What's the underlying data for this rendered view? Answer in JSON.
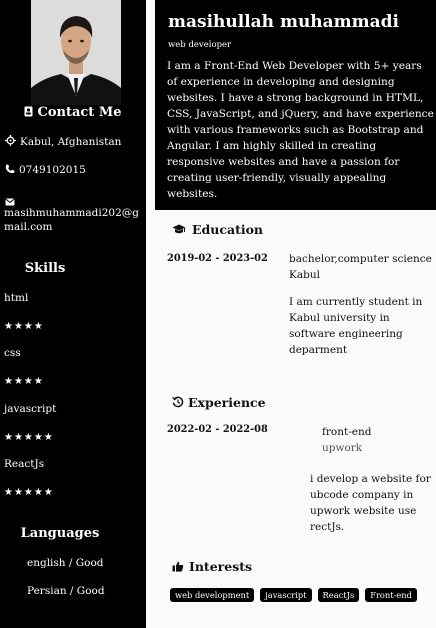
{
  "profile": {
    "name": "masihullah muhammadi",
    "role": "web developer",
    "summary": "I am a Front-End Web Developer with 5+ years of experience in developing and designing websites. I have a strong background in HTML, CSS, JavaScript, and jQuery, and have experience with various frameworks such as Bootstrap and Angular. I am highly skilled in creating responsive websites and have a passion for creating user-friendly, visually appealing websites."
  },
  "contact": {
    "title": "Contact Me",
    "location": "Kabul, Afghanistan",
    "phone": "0749102015",
    "email": "masihmuhammadi202@gmail.com"
  },
  "skills": {
    "title": "Skills",
    "items": [
      {
        "name": "html",
        "stars": "★★★★",
        "rating": 4
      },
      {
        "name": "css",
        "stars": "★★★★",
        "rating": 4
      },
      {
        "name": "javascript",
        "stars": "★★★★★",
        "rating": 5
      },
      {
        "name": "ReactJs",
        "stars": "★★★★★",
        "rating": 5
      }
    ]
  },
  "languages": {
    "title": "Languages",
    "items": [
      "english / Good",
      "Persian / Good"
    ]
  },
  "education": {
    "title": "Education",
    "dates": "2019-02 - 2023-02",
    "degree": "bachelor,computer science",
    "place": "Kabul",
    "description": "I am currently student in Kabul university in software engineering deparment"
  },
  "experience": {
    "title": "Experience",
    "dates": "2022-02 - 2022-08",
    "position": "front-end",
    "company": "upwork",
    "description": "i develop a website for ubcode company in upwork website use rectJs."
  },
  "interests": {
    "title": "Interests",
    "tags": [
      "web development",
      "javascript",
      "ReactJs",
      "Front-end"
    ]
  },
  "colors": {
    "sidebar_bg": "#000000",
    "header_bg": "#000000",
    "page_bg": "#fafafa",
    "tag_bg": "#000000"
  }
}
